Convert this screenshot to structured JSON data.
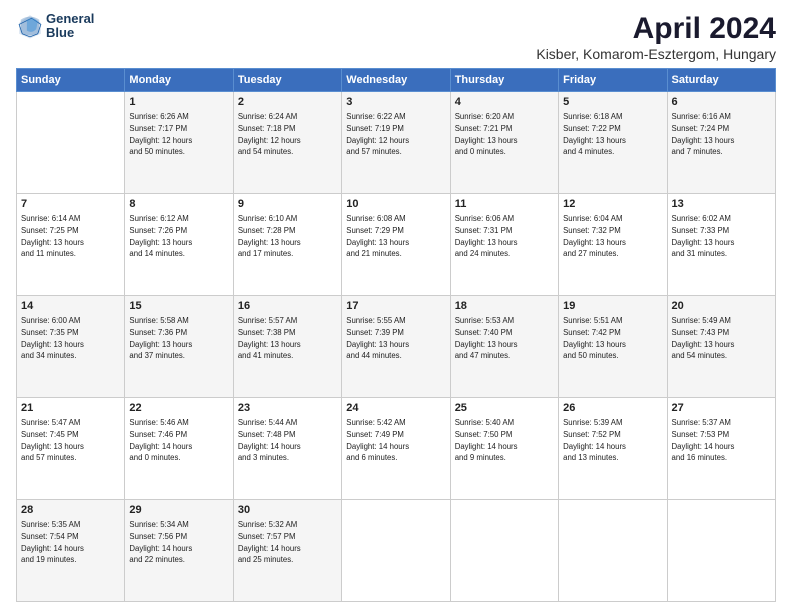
{
  "header": {
    "logo_line1": "General",
    "logo_line2": "Blue",
    "title": "April 2024",
    "subtitle": "Kisber, Komarom-Esztergom, Hungary"
  },
  "days_of_week": [
    "Sunday",
    "Monday",
    "Tuesday",
    "Wednesday",
    "Thursday",
    "Friday",
    "Saturday"
  ],
  "weeks": [
    [
      {
        "day": "",
        "info": ""
      },
      {
        "day": "1",
        "info": "Sunrise: 6:26 AM\nSunset: 7:17 PM\nDaylight: 12 hours\nand 50 minutes."
      },
      {
        "day": "2",
        "info": "Sunrise: 6:24 AM\nSunset: 7:18 PM\nDaylight: 12 hours\nand 54 minutes."
      },
      {
        "day": "3",
        "info": "Sunrise: 6:22 AM\nSunset: 7:19 PM\nDaylight: 12 hours\nand 57 minutes."
      },
      {
        "day": "4",
        "info": "Sunrise: 6:20 AM\nSunset: 7:21 PM\nDaylight: 13 hours\nand 0 minutes."
      },
      {
        "day": "5",
        "info": "Sunrise: 6:18 AM\nSunset: 7:22 PM\nDaylight: 13 hours\nand 4 minutes."
      },
      {
        "day": "6",
        "info": "Sunrise: 6:16 AM\nSunset: 7:24 PM\nDaylight: 13 hours\nand 7 minutes."
      }
    ],
    [
      {
        "day": "7",
        "info": "Sunrise: 6:14 AM\nSunset: 7:25 PM\nDaylight: 13 hours\nand 11 minutes."
      },
      {
        "day": "8",
        "info": "Sunrise: 6:12 AM\nSunset: 7:26 PM\nDaylight: 13 hours\nand 14 minutes."
      },
      {
        "day": "9",
        "info": "Sunrise: 6:10 AM\nSunset: 7:28 PM\nDaylight: 13 hours\nand 17 minutes."
      },
      {
        "day": "10",
        "info": "Sunrise: 6:08 AM\nSunset: 7:29 PM\nDaylight: 13 hours\nand 21 minutes."
      },
      {
        "day": "11",
        "info": "Sunrise: 6:06 AM\nSunset: 7:31 PM\nDaylight: 13 hours\nand 24 minutes."
      },
      {
        "day": "12",
        "info": "Sunrise: 6:04 AM\nSunset: 7:32 PM\nDaylight: 13 hours\nand 27 minutes."
      },
      {
        "day": "13",
        "info": "Sunrise: 6:02 AM\nSunset: 7:33 PM\nDaylight: 13 hours\nand 31 minutes."
      }
    ],
    [
      {
        "day": "14",
        "info": "Sunrise: 6:00 AM\nSunset: 7:35 PM\nDaylight: 13 hours\nand 34 minutes."
      },
      {
        "day": "15",
        "info": "Sunrise: 5:58 AM\nSunset: 7:36 PM\nDaylight: 13 hours\nand 37 minutes."
      },
      {
        "day": "16",
        "info": "Sunrise: 5:57 AM\nSunset: 7:38 PM\nDaylight: 13 hours\nand 41 minutes."
      },
      {
        "day": "17",
        "info": "Sunrise: 5:55 AM\nSunset: 7:39 PM\nDaylight: 13 hours\nand 44 minutes."
      },
      {
        "day": "18",
        "info": "Sunrise: 5:53 AM\nSunset: 7:40 PM\nDaylight: 13 hours\nand 47 minutes."
      },
      {
        "day": "19",
        "info": "Sunrise: 5:51 AM\nSunset: 7:42 PM\nDaylight: 13 hours\nand 50 minutes."
      },
      {
        "day": "20",
        "info": "Sunrise: 5:49 AM\nSunset: 7:43 PM\nDaylight: 13 hours\nand 54 minutes."
      }
    ],
    [
      {
        "day": "21",
        "info": "Sunrise: 5:47 AM\nSunset: 7:45 PM\nDaylight: 13 hours\nand 57 minutes."
      },
      {
        "day": "22",
        "info": "Sunrise: 5:46 AM\nSunset: 7:46 PM\nDaylight: 14 hours\nand 0 minutes."
      },
      {
        "day": "23",
        "info": "Sunrise: 5:44 AM\nSunset: 7:48 PM\nDaylight: 14 hours\nand 3 minutes."
      },
      {
        "day": "24",
        "info": "Sunrise: 5:42 AM\nSunset: 7:49 PM\nDaylight: 14 hours\nand 6 minutes."
      },
      {
        "day": "25",
        "info": "Sunrise: 5:40 AM\nSunset: 7:50 PM\nDaylight: 14 hours\nand 9 minutes."
      },
      {
        "day": "26",
        "info": "Sunrise: 5:39 AM\nSunset: 7:52 PM\nDaylight: 14 hours\nand 13 minutes."
      },
      {
        "day": "27",
        "info": "Sunrise: 5:37 AM\nSunset: 7:53 PM\nDaylight: 14 hours\nand 16 minutes."
      }
    ],
    [
      {
        "day": "28",
        "info": "Sunrise: 5:35 AM\nSunset: 7:54 PM\nDaylight: 14 hours\nand 19 minutes."
      },
      {
        "day": "29",
        "info": "Sunrise: 5:34 AM\nSunset: 7:56 PM\nDaylight: 14 hours\nand 22 minutes."
      },
      {
        "day": "30",
        "info": "Sunrise: 5:32 AM\nSunset: 7:57 PM\nDaylight: 14 hours\nand 25 minutes."
      },
      {
        "day": "",
        "info": ""
      },
      {
        "day": "",
        "info": ""
      },
      {
        "day": "",
        "info": ""
      },
      {
        "day": "",
        "info": ""
      }
    ]
  ]
}
